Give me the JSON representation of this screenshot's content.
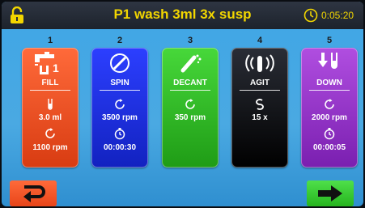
{
  "header": {
    "title": "P1 wash 3ml 3x susp",
    "time": "0:05:20",
    "lock_icon": "lock-icon",
    "clock_icon": "clock-icon",
    "accent_color": "#f2d600"
  },
  "steps": [
    {
      "number": "1",
      "name": "FILL",
      "color": "#e8451a",
      "icon": "faucet-icon",
      "icon_badge": "1",
      "values": [
        {
          "icon": "tube-icon",
          "text": "3.0 ml"
        },
        {
          "icon": "rotate-icon",
          "text": "1100 rpm"
        }
      ]
    },
    {
      "number": "2",
      "name": "SPIN",
      "color": "#1a2be0",
      "icon": "rotor-icon",
      "values": [
        {
          "icon": "rotate-icon",
          "text": "3500 rpm"
        },
        {
          "icon": "timer-icon",
          "text": "00:00:30"
        }
      ]
    },
    {
      "number": "3",
      "name": "DECANT",
      "color": "#2fb626",
      "icon": "decant-icon",
      "values": [
        {
          "icon": "rotate-icon",
          "text": "350 rpm"
        }
      ]
    },
    {
      "number": "4",
      "name": "AGIT",
      "color": "#15181e",
      "icon": "agitate-icon",
      "values": [
        {
          "icon": "shake-icon",
          "text": "15 x"
        }
      ]
    },
    {
      "number": "5",
      "name": "DOWN",
      "color": "#9a33cc",
      "icon": "down-tube-icon",
      "values": [
        {
          "icon": "rotate-icon",
          "text": "2000 rpm"
        },
        {
          "icon": "timer-icon",
          "text": "00:00:05"
        }
      ]
    }
  ],
  "footer": {
    "back_icon": "return-arrow-icon",
    "next_icon": "right-arrow-icon"
  }
}
